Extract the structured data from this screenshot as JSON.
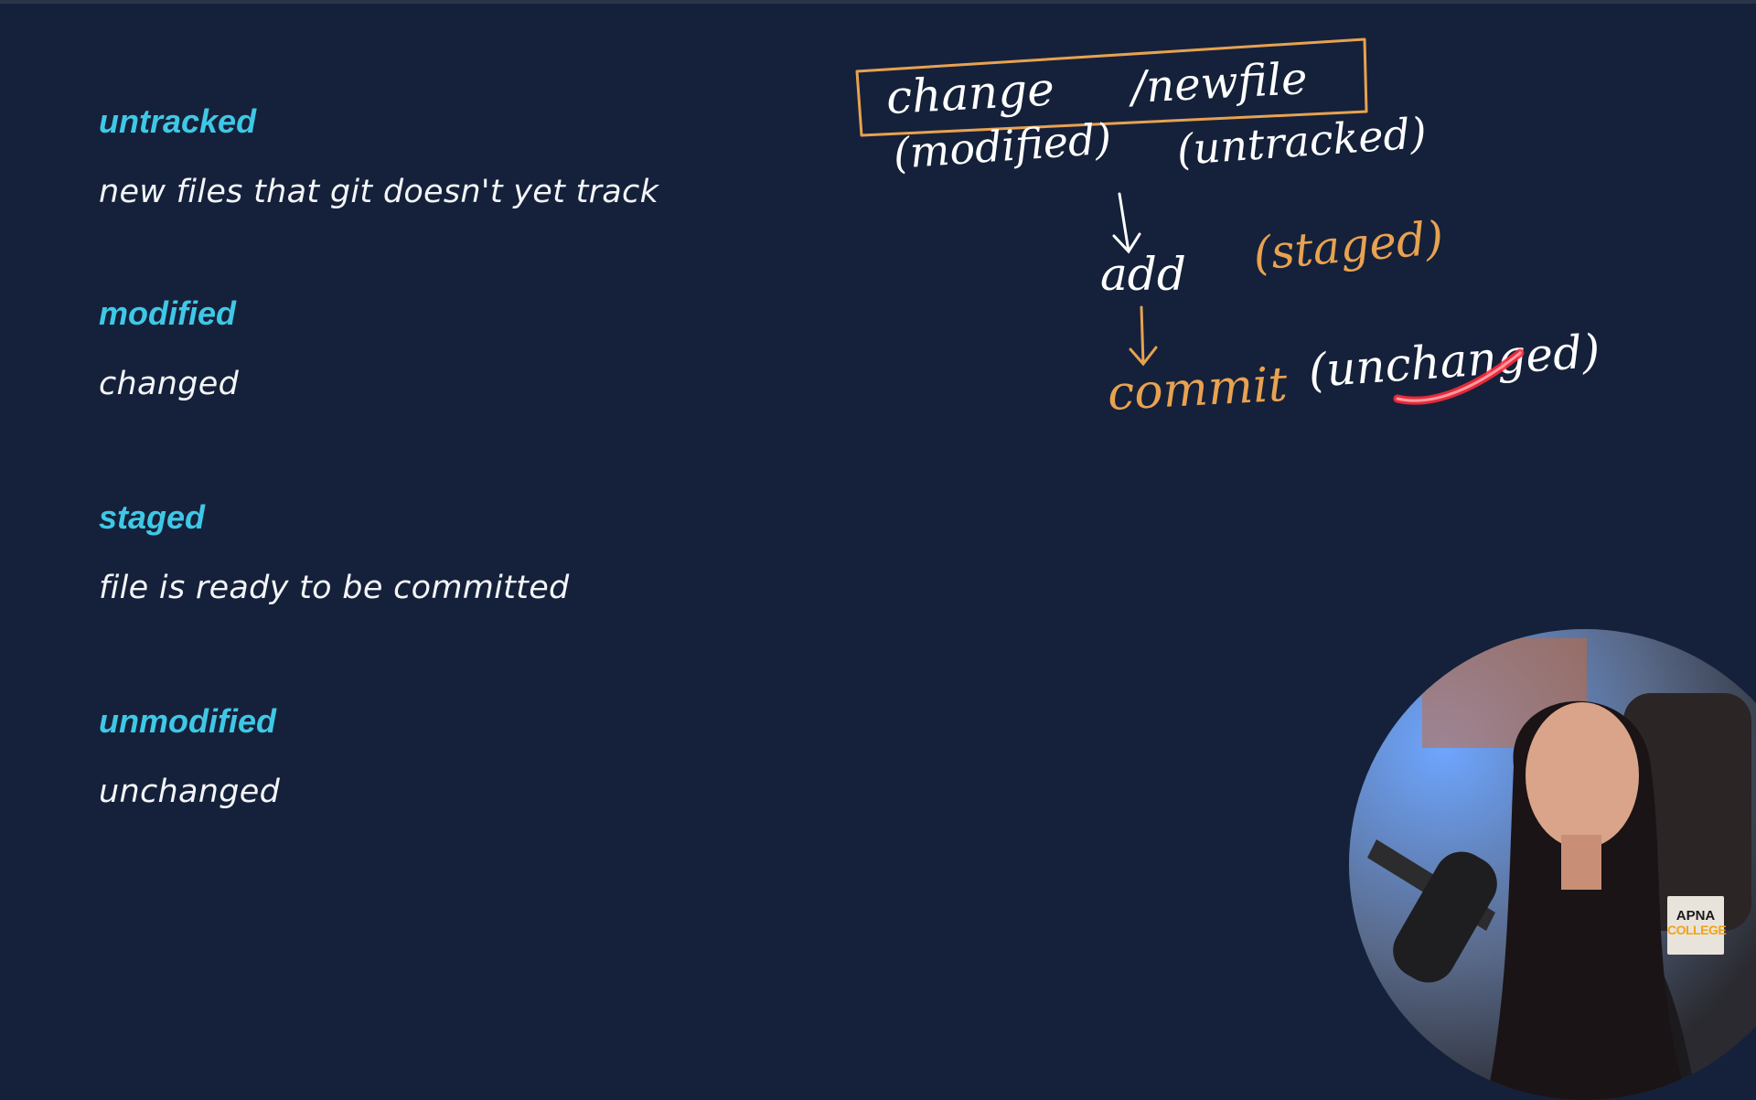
{
  "terms": [
    {
      "term": "untracked",
      "desc": "new files that git doesn't yet track"
    },
    {
      "term": "modified",
      "desc": "changed"
    },
    {
      "term": "staged",
      "desc": "file is ready to be committed"
    },
    {
      "term": "unmodified",
      "desc": "unchanged"
    }
  ],
  "board": {
    "change": "change",
    "new_file": "/newfile",
    "modified": "(modified)",
    "untracked": "(untracked)",
    "add": "add",
    "staged": "(staged)",
    "commit": "commit",
    "unchanged": "(unchanged)"
  },
  "logo": {
    "line1": "APNA",
    "line2": "COLLEGE"
  },
  "colors": {
    "background": "#15213a",
    "term": "#3fc8e6",
    "description": "#f3f5f8",
    "ink_white": "#ffffff",
    "ink_orange": "#e8a250",
    "ink_red": "#ff2a3a"
  }
}
